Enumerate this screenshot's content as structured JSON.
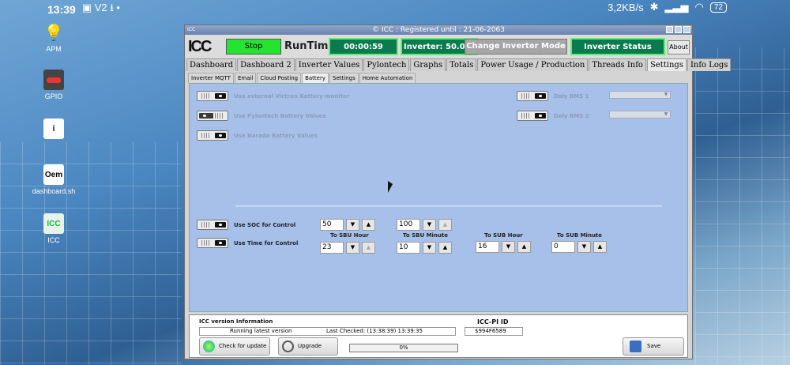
{
  "statusbar": {
    "time": "13:39",
    "left_icons": "▣ V2 ⭳ •",
    "speed": "3,2KB/s",
    "battery": "72"
  },
  "desktop_icons": [
    {
      "label": "APM"
    },
    {
      "label": "GPIO"
    },
    {
      "label": ""
    },
    {
      "label": "dashboard.sh"
    },
    {
      "label": "ICC"
    }
  ],
  "desktop_icon_glyphs": {
    "oem": "Oem",
    "info": "i",
    "icc": "ICC"
  },
  "window": {
    "corner_label": "ICC",
    "title": "© ICC : Registered until : 21-06-2063",
    "logo": "ICC",
    "stop_label": "Stop",
    "runtime_label": "RunTime",
    "runtime_value": "00:00:59",
    "inverter_temp": "Inverter: 50.0°C",
    "change_mode_label": "Change Inverter Mode",
    "inverter_status_label": "Inverter Status",
    "about_label": "About"
  },
  "tabs": [
    "Dashboard",
    "Dashboard 2",
    "Inverter Values",
    "Pylontech",
    "Graphs",
    "Totals",
    "Power Usage / Production",
    "Threads Info",
    "Settings",
    "Info Logs"
  ],
  "active_tab": "Settings",
  "subtabs": [
    "Inverter MQTT",
    "Email",
    "Cloud Posting",
    "Battery",
    "Settings",
    "Home Automation"
  ],
  "active_subtab": "Battery",
  "battery": {
    "use_victron": "Use external Victron Battery monitor",
    "use_pylontech": "Use Pylontech Battery Values",
    "use_narada": "Use Narada Battery Values",
    "daly_bms1": "Daly BMS 1",
    "daly_bms2": "Daly BMS 2",
    "use_soc": "Use SOC for Control",
    "use_time": "Use Time for Control",
    "soc_low": "50",
    "soc_high": "100",
    "to_sbu_hour_label": "To SBU Hour",
    "to_sbu_minute_label": "To SBU Minute",
    "to_sub_hour_label": "To SUB Hour",
    "to_sub_minute_label": "To SUB Minute",
    "to_sbu_hour": "23",
    "to_sbu_minute": "10",
    "to_sub_hour": "16",
    "to_sub_minute": "0"
  },
  "footer": {
    "version_info_label": "ICC version Information",
    "running_status": "Running latest version",
    "last_checked": "Last Checked: (13:38:39)  13:39:35",
    "icc_pi_id_label": "ICC-PI ID",
    "icc_pi_id": "$994F6589",
    "check_update_label": "Check for update",
    "upgrade_label": "Upgrade",
    "progress": "0%",
    "progress_fraction": 0,
    "save_label": "Save"
  },
  "colors": {
    "stop_green": "#23e52f",
    "status_green": "#0b7a4f",
    "content_blue": "#a6c0ea"
  }
}
